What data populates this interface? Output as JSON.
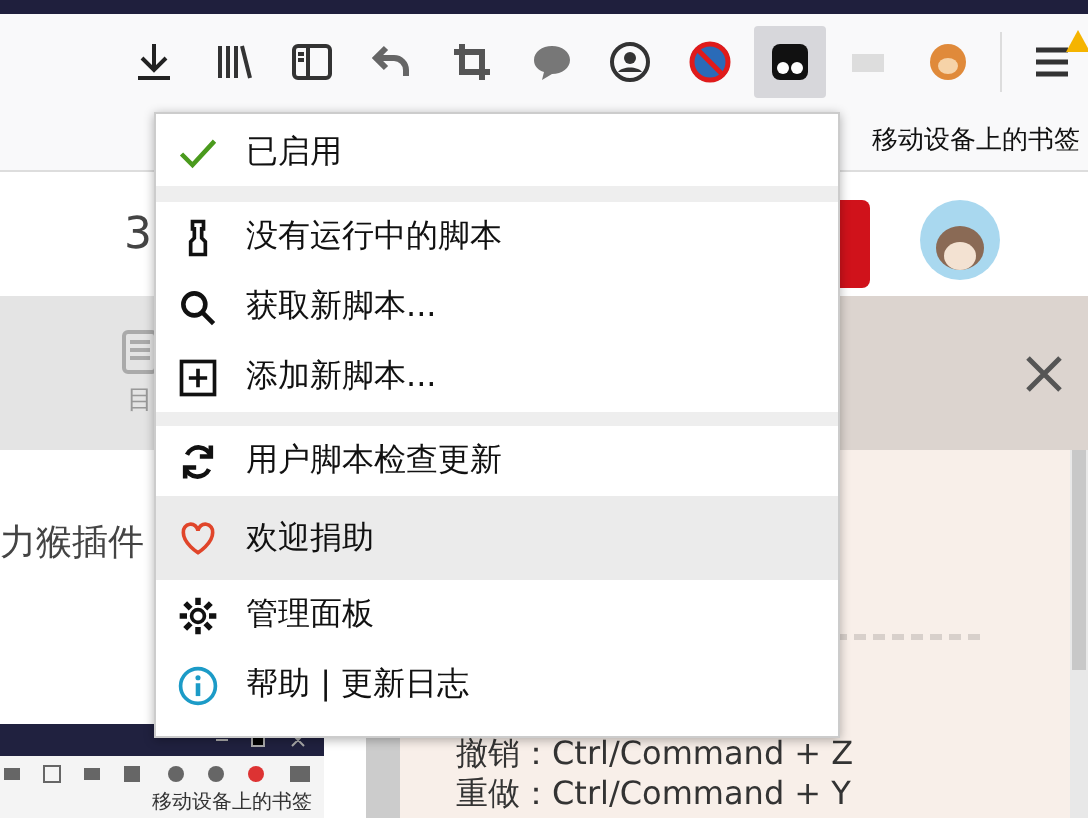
{
  "toolbar": {
    "buttons": [
      {
        "selected": false
      },
      {
        "selected": false
      },
      {
        "selected": false
      },
      {
        "selected": false
      },
      {
        "selected": false
      },
      {
        "selected": false
      },
      {
        "selected": false
      },
      {
        "selected": false
      },
      {
        "selected": true
      },
      {
        "selected": false
      },
      {
        "selected": false
      }
    ]
  },
  "bookmarks_bar": {
    "label": "移动设备上的书签"
  },
  "page": {
    "partial_number": "3",
    "tab_label": "目",
    "partial_title": "力猴插件",
    "shortcuts": [
      "撤销：Ctrl/Command + Z",
      "重做：Ctrl/Command + Y"
    ],
    "embedded_screenshot": {
      "bookmark": "移动设备上的书签"
    }
  },
  "menu": {
    "status": {
      "label": "已启用",
      "enabled": true
    },
    "sections": [
      [
        {
          "label": "没有运行中的脚本",
          "highlighted": false
        },
        {
          "label": "获取新脚本...",
          "highlighted": false
        },
        {
          "label": "添加新脚本...",
          "highlighted": false
        }
      ],
      [
        {
          "label": "用户脚本检查更新",
          "highlighted": false
        },
        {
          "label": "欢迎捐助",
          "highlighted": true
        },
        {
          "label": "管理面板",
          "highlighted": false
        },
        {
          "label": "帮助 | 更新日志",
          "highlighted": false
        }
      ]
    ]
  }
}
